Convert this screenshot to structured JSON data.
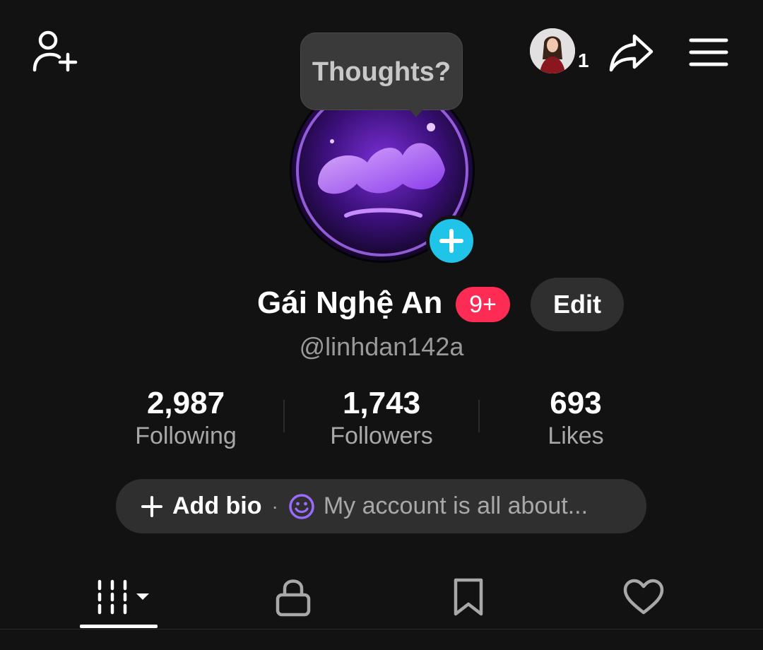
{
  "header": {
    "add_friend_icon": "person-plus-icon",
    "account_switch_count": "1",
    "share_icon": "share-arrow-icon",
    "menu_icon": "hamburger-menu-icon"
  },
  "tooltip": {
    "text": "Thoughts?"
  },
  "profile": {
    "name": "Gái Nghệ An",
    "notification_badge": "9+",
    "edit_label": "Edit",
    "handle": "@linhdan142a"
  },
  "stats": [
    {
      "value": "2,987",
      "label": "Following"
    },
    {
      "value": "1,743",
      "label": "Followers"
    },
    {
      "value": "693",
      "label": "Likes"
    }
  ],
  "bio": {
    "add_label": "Add bio",
    "separator": "·",
    "placeholder": "My account is all about..."
  },
  "tabs": [
    {
      "icon": "videos-grid-icon",
      "active": true
    },
    {
      "icon": "lock-icon",
      "active": false
    },
    {
      "icon": "bookmark-icon",
      "active": false
    },
    {
      "icon": "heart-icon",
      "active": false
    }
  ],
  "colors": {
    "background": "#121212",
    "accent_pink": "#fe2c55",
    "accent_cyan": "#20c4e8",
    "emoji_purple": "#9b6bff"
  }
}
